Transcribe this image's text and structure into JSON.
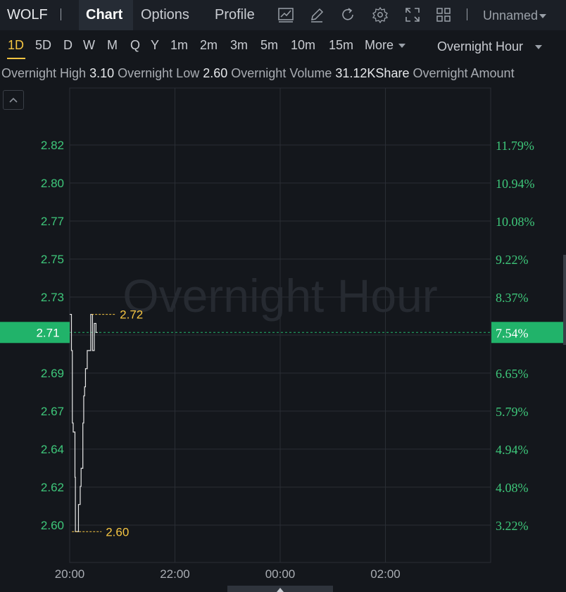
{
  "header": {
    "ticker": "WOLF",
    "tabs": [
      {
        "label": "Chart",
        "active": true
      },
      {
        "label": "Options",
        "active": false
      },
      {
        "label": "Profile",
        "active": false
      }
    ],
    "tools": [
      "line-chart-icon",
      "pencil-icon",
      "refresh-icon",
      "gear-icon",
      "expand-icon",
      "grid-layout-icon"
    ],
    "layout_name": "Unnamed"
  },
  "periods": {
    "items": [
      "1D",
      "5D",
      "D",
      "W",
      "M",
      "Q",
      "Y",
      "1m",
      "2m",
      "3m",
      "5m",
      "10m",
      "15m"
    ],
    "more": "More",
    "active": "1D",
    "session": "Overnight Hour"
  },
  "stats": {
    "high_label": "Overnight High",
    "high_value": "3.10",
    "low_label": "Overnight Low",
    "low_value": "2.60",
    "volume_label": "Overnight Volume",
    "volume_value": "31.12KShare",
    "amount_label": "Overnight Amount"
  },
  "colors": {
    "background": "#14171c",
    "grid": "#2a2e35",
    "axis_text": "#3ec77a",
    "current_marker": "#21b36a",
    "price_line": "#e8e8e8",
    "annotation": "#f5c542"
  },
  "chart_data": {
    "type": "line",
    "watermark": "Overnight Hour",
    "x_ticks": [
      "20:00",
      "22:00",
      "00:00",
      "02:00"
    ],
    "y_left_ticks": [
      "2.82",
      "2.80",
      "2.77",
      "2.75",
      "2.73",
      "2.71",
      "2.69",
      "2.67",
      "2.64",
      "2.62",
      "2.60"
    ],
    "y_right_ticks": [
      "11.79%",
      "10.94%",
      "10.08%",
      "9.22%",
      "8.37%",
      "7.54%",
      "6.65%",
      "5.79%",
      "4.94%",
      "4.08%",
      "3.22%"
    ],
    "ylim": [
      2.583,
      2.845
    ],
    "xlim_minutes": [
      0,
      480
    ],
    "current_price": "2.71",
    "current_pct": "7.54%",
    "max_annotation": {
      "label": "2.72",
      "value": 2.72
    },
    "min_annotation": {
      "label": "2.60",
      "value": 2.6
    },
    "series": [
      {
        "x": [
          0,
          1,
          2,
          3,
          4,
          5,
          6,
          6.5,
          7,
          9,
          10,
          11,
          12,
          13,
          14,
          15,
          16,
          17,
          18,
          19,
          20,
          21,
          22,
          23,
          24,
          25,
          26,
          27,
          28,
          29,
          30,
          31,
          32
        ],
        "y": [
          2.72,
          2.72,
          2.7,
          2.66,
          2.655,
          2.655,
          2.63,
          2.6,
          2.6,
          2.6,
          2.615,
          2.615,
          2.625,
          2.635,
          2.635,
          2.66,
          2.675,
          2.68,
          2.69,
          2.69,
          2.7,
          2.7,
          2.7,
          2.7,
          2.72,
          2.72,
          2.7,
          2.7,
          2.715,
          2.715,
          2.71,
          2.71,
          2.71
        ]
      }
    ]
  }
}
